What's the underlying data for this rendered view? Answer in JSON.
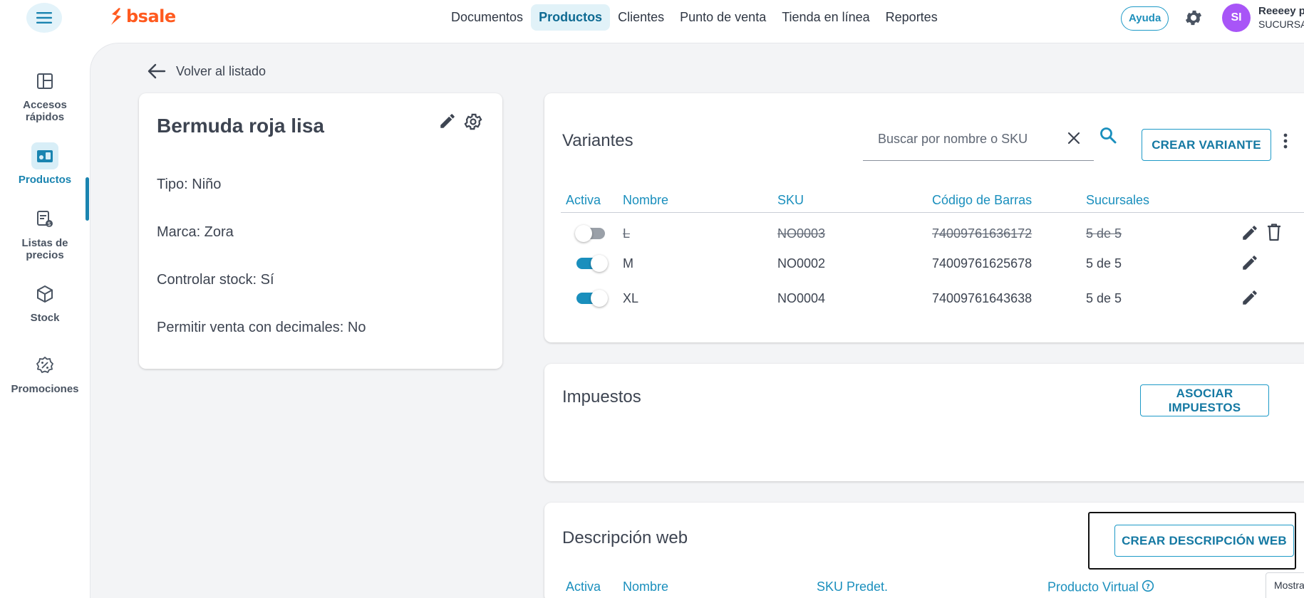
{
  "app": {
    "logo_text": "bsale",
    "brand_color": "#ff5a1f",
    "accent_color": "#1a8fbd"
  },
  "topnav": {
    "items": [
      "Documentos",
      "Productos",
      "Clientes",
      "Punto de venta",
      "Tienda en línea",
      "Reportes"
    ],
    "active": "Productos"
  },
  "header": {
    "help_label": "Ayuda",
    "avatar_initials": "SI",
    "user_name": "Reeeey p",
    "user_branch": "SUCURSA"
  },
  "sidebar": {
    "items": [
      {
        "label": "Accesos rápidos",
        "icon": "dashboard-icon"
      },
      {
        "label": "Productos",
        "icon": "products-icon",
        "active": true
      },
      {
        "label": "Listas de precios",
        "icon": "price-list-icon"
      },
      {
        "label": "Stock",
        "icon": "box-icon"
      },
      {
        "label": "Promociones",
        "icon": "discount-badge-icon"
      }
    ]
  },
  "back_link": "Volver al listado",
  "product": {
    "title": "Bermuda roja lisa",
    "attributes": [
      "Tipo: Niño",
      "Marca: Zora",
      "Controlar stock: Sí",
      "Permitir venta con decimales: No"
    ]
  },
  "variants": {
    "title": "Variantes",
    "search_placeholder": "Buscar por nombre o SKU",
    "create_button": "CREAR VARIANTE",
    "columns": [
      "Activa",
      "Nombre",
      "SKU",
      "Código de Barras",
      "Sucursales"
    ],
    "rows": [
      {
        "active": false,
        "name": "L",
        "sku": "NO0003",
        "barcode": "74009761636172",
        "branches": "5 de 5"
      },
      {
        "active": true,
        "name": "M",
        "sku": "NO0002",
        "barcode": "74009761625678",
        "branches": "5 de 5"
      },
      {
        "active": true,
        "name": "XL",
        "sku": "NO0004",
        "barcode": "74009761643638",
        "branches": "5 de 5"
      }
    ]
  },
  "taxes": {
    "title": "Impuestos",
    "button": "ASOCIAR IMPUESTOS"
  },
  "web_description": {
    "title": "Descripción web",
    "button": "CREAR DESCRIPCIÓN WEB",
    "columns": [
      "Activa",
      "Nombre",
      "SKU Predet.",
      "Producto Virtual"
    ]
  },
  "bottom_tab": "Mostra"
}
